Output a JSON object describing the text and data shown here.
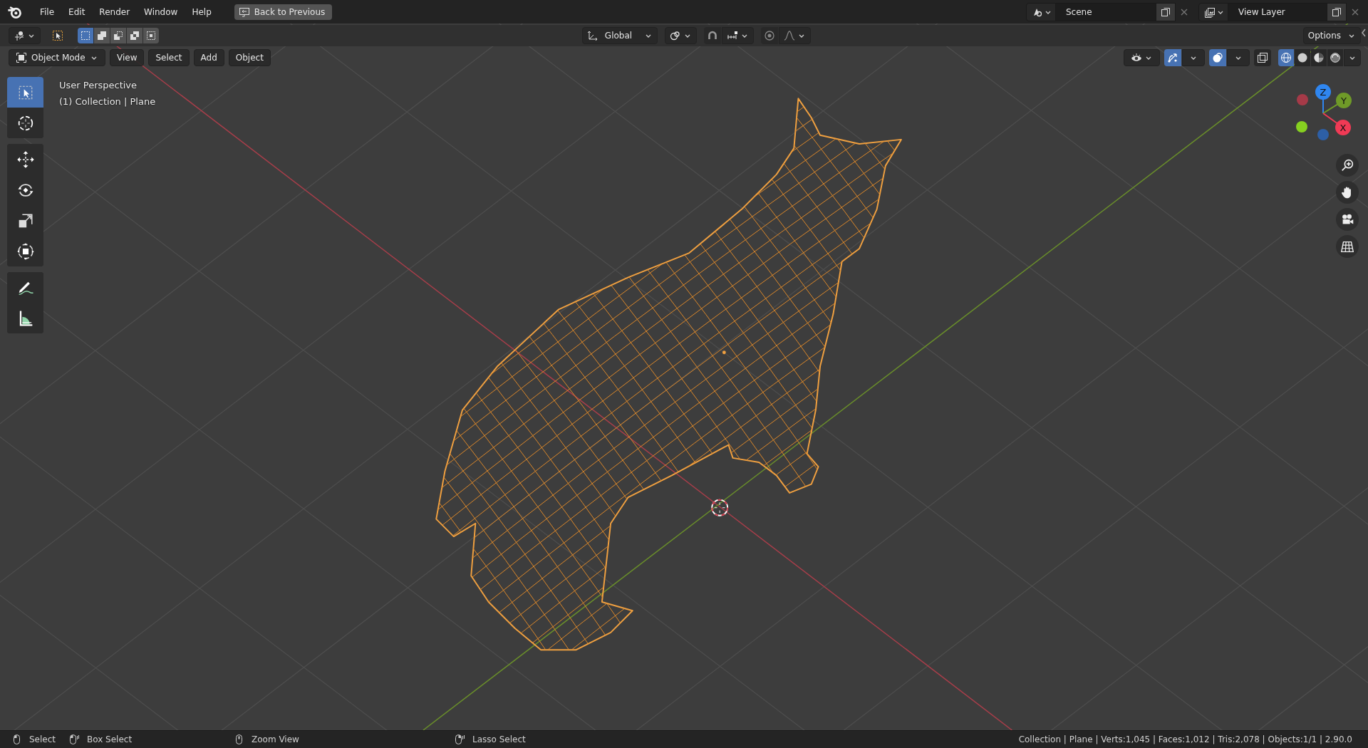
{
  "top_bar": {
    "menus": [
      {
        "label": "File"
      },
      {
        "label": "Edit"
      },
      {
        "label": "Render"
      },
      {
        "label": "Window"
      },
      {
        "label": "Help"
      }
    ],
    "back_button": {
      "label": "Back to Previous"
    },
    "scene": {
      "value": "Scene"
    },
    "view_layer": {
      "value": "View Layer"
    }
  },
  "tool_header": {
    "select_modes": [
      {
        "kind": "set",
        "selected": true
      },
      {
        "kind": "extend",
        "selected": false
      },
      {
        "kind": "subtract",
        "selected": false
      },
      {
        "kind": "difference",
        "selected": false
      },
      {
        "kind": "intersect",
        "selected": false
      }
    ],
    "orientation": {
      "value": "Global"
    },
    "snap_on": false,
    "proportional_on": false,
    "options": {
      "label": "Options"
    }
  },
  "viewport_header": {
    "mode": {
      "value": "Object Mode"
    },
    "menus": [
      {
        "label": "View"
      },
      {
        "label": "Select"
      },
      {
        "label": "Add"
      },
      {
        "label": "Object"
      }
    ],
    "show_gizmos": true,
    "show_overlays": true,
    "xray": false,
    "shading_modes": [
      {
        "kind": "wireframe",
        "selected": true
      },
      {
        "kind": "solid",
        "selected": false
      },
      {
        "kind": "material",
        "selected": false
      },
      {
        "kind": "rendered",
        "selected": false
      }
    ]
  },
  "toolbar": {
    "tools": [
      {
        "kind": "select_box",
        "selected": true
      },
      {
        "kind": "cursor",
        "selected": false
      },
      {
        "kind": "move",
        "selected": false
      },
      {
        "kind": "rotate",
        "selected": false
      },
      {
        "kind": "scale",
        "selected": false
      },
      {
        "kind": "transform",
        "selected": false
      },
      {
        "kind": "annotate",
        "selected": false
      },
      {
        "kind": "measure",
        "selected": false
      }
    ]
  },
  "viewport": {
    "overlay_text": [
      "User Perspective",
      "(1) Collection | Plane"
    ],
    "axis_handles": [
      {
        "kind": "z",
        "label": "Z"
      },
      {
        "kind": "y",
        "label": "Y"
      },
      {
        "kind": "x",
        "label": "X"
      }
    ]
  },
  "status_bar": {
    "hints": [
      {
        "kind": "left_click",
        "label": "Select"
      },
      {
        "kind": "left_drag",
        "label": "Box Select"
      },
      {
        "kind": "middle",
        "label": "Zoom View"
      },
      {
        "kind": "right_drag",
        "label": "Lasso Select"
      }
    ],
    "stats": "Collection | Plane | Verts:1,045 | Faces:1,012 | Tris:2,078 | Objects:1/1 | 2.90.0"
  }
}
